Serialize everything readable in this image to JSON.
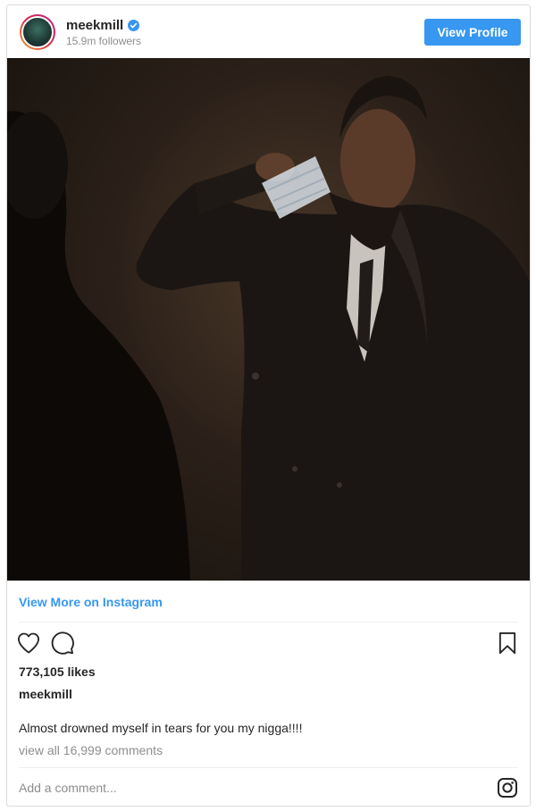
{
  "header": {
    "username": "meekmill",
    "followers": "15.9m followers",
    "view_profile_label": "View Profile"
  },
  "post": {
    "view_more_label": "View More on Instagram",
    "likes": "773,105 likes",
    "poster_username": "meekmill",
    "caption": "Almost drowned myself in tears for you my nigga!!!!",
    "view_comments": "view all 16,999 comments",
    "comment_placeholder": "Add a comment..."
  },
  "icons": {
    "like": "heart-icon",
    "comment": "comment-icon",
    "save": "bookmark-icon",
    "verified": "verified-badge-icon",
    "instagram": "instagram-logo-icon"
  },
  "colors": {
    "accent": "#3897f0",
    "text": "#262626",
    "muted": "#8e8e8e"
  }
}
